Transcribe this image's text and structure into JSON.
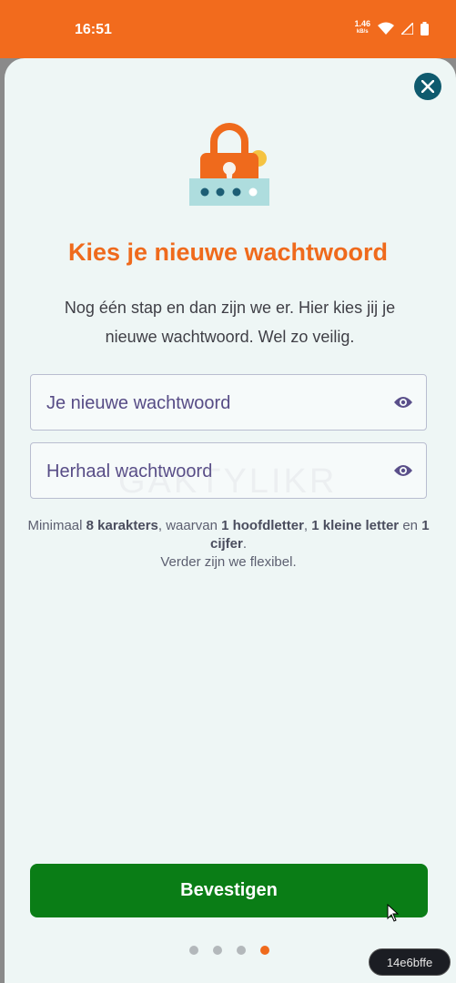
{
  "status_bar": {
    "time": "16:51",
    "net_speed_value": "1.46",
    "net_speed_unit": "kB/s",
    "icons": [
      "wifi-icon",
      "signal-icon",
      "battery-icon"
    ]
  },
  "colors": {
    "brand_orange": "#ef6a1c",
    "primary_green": "#0a7d16",
    "close_teal": "#0f5a6e",
    "sheet_bg": "#eef6f5"
  },
  "dialog": {
    "title": "Kies je nieuwe wachtwoord",
    "intro": "Nog één stap en dan zijn we er. Hier kies jij je nieuwe wachtwoord. Wel zo veilig.",
    "new_password_placeholder": "Je nieuwe wachtwoord",
    "repeat_password_placeholder": "Herhaal wachtwoord",
    "watermark": "GAKTYLIKR",
    "hint": {
      "p1": "Minimaal ",
      "b1": "8 karakters",
      "p2": ", waarvan ",
      "b2": "1 hoofdletter",
      "p3": ", ",
      "b3": "1 kleine letter",
      "p4": " en ",
      "b4": "1 cijfer",
      "p5": ".",
      "line2": "Verder zijn we flexibel."
    },
    "confirm_label": "Bevestigen"
  },
  "pagination": {
    "total": 4,
    "active": 4
  },
  "overlay": {
    "badge": "14e6bffe"
  }
}
